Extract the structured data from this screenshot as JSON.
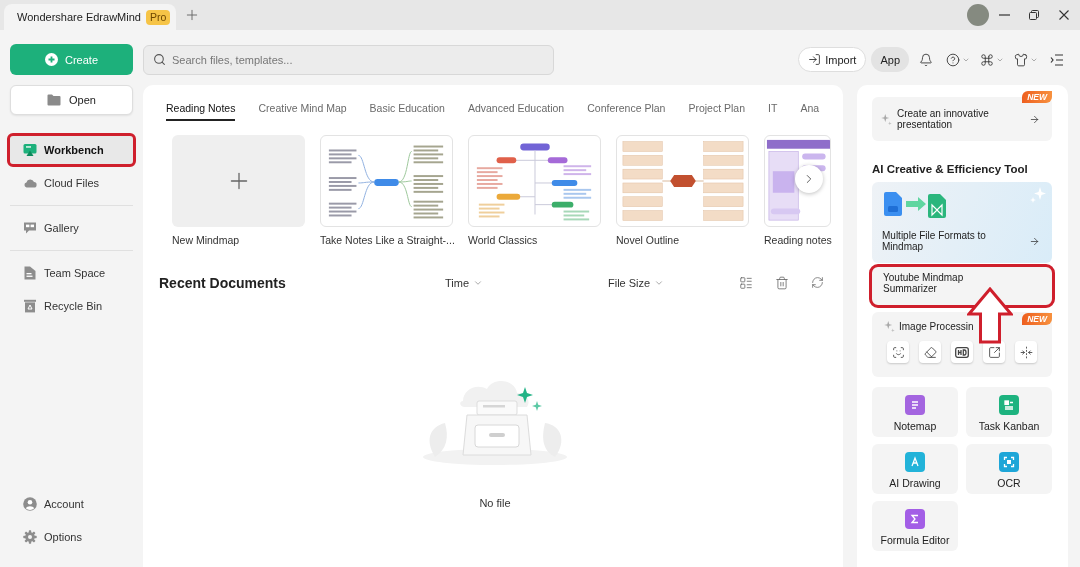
{
  "title_bar": {
    "app_name": "Wondershare EdrawMind",
    "badge": "Pro"
  },
  "toolbar": {
    "create_button": "Create",
    "search": {
      "placeholder": "Search files, templates..."
    },
    "import_button": "Import",
    "app_button": "App"
  },
  "sidebar": {
    "open_button": "Open",
    "groups": [
      {
        "items": [
          {
            "label": "Workbench",
            "selected": true,
            "highlighted": true
          },
          {
            "label": "Cloud Files",
            "selected": false,
            "highlighted": false
          }
        ]
      },
      {
        "items": [
          {
            "label": "Gallery",
            "selected": false,
            "highlighted": false
          }
        ]
      },
      {
        "items": [
          {
            "label": "Team Space",
            "selected": false,
            "highlighted": false
          },
          {
            "label": "Recycle Bin",
            "selected": false,
            "highlighted": false
          }
        ]
      }
    ],
    "bottom_items": [
      {
        "label": "Account",
        "selected": false
      },
      {
        "label": "Options",
        "selected": false
      }
    ]
  },
  "templates": {
    "tabs": [
      {
        "label": "Reading Notes",
        "selected": true
      },
      {
        "label": "Creative Mind Map",
        "selected": false
      },
      {
        "label": "Basic Education",
        "selected": false
      },
      {
        "label": "Advanced Education",
        "selected": false
      },
      {
        "label": "Conference Plan",
        "selected": false
      },
      {
        "label": "Project Plan",
        "selected": false
      },
      {
        "label": "IT",
        "selected": false
      },
      {
        "label": "Ana",
        "selected": false
      }
    ],
    "cards": [
      {
        "kind": "blank",
        "label": "New Mindmap"
      },
      {
        "kind": "radial",
        "label": "Take Notes Like a Straight-..."
      },
      {
        "kind": "tree",
        "label": "World Classics"
      },
      {
        "kind": "columns",
        "label": "Novel Outline"
      },
      {
        "kind": "board",
        "label": "Reading notes"
      }
    ]
  },
  "recent_documents": {
    "title": "Recent Documents",
    "sort_options": [
      "Time",
      "File Size"
    ],
    "empty_text": "No file"
  },
  "right_panel": {
    "promo": {
      "text": "Create an innovative presentation",
      "badge": "NEW"
    },
    "section_title": "AI Creative & Efficiency Tool",
    "feature_cards": [
      {
        "kind": "converter",
        "text": "Multiple File Formats to Mindmap",
        "highlighted": false,
        "arrow_pointer": false
      },
      {
        "kind": "plain",
        "text": "Youtube Mindmap Summarizer",
        "highlighted": true,
        "arrow_pointer": true
      },
      {
        "kind": "image-tools",
        "text": "Image Processin",
        "badge": "NEW",
        "highlighted": false,
        "arrow_pointer": false
      }
    ],
    "tiles": [
      {
        "label": "Notemap",
        "color": "#a465e0"
      },
      {
        "label": "Task Kanban",
        "color": "#1db37f"
      },
      {
        "label": "AI Drawing",
        "color": "#22b3d9"
      },
      {
        "label": "OCR",
        "color": "#1ea6d8"
      },
      {
        "label": "Formula Editor",
        "color": "#a35ee6"
      }
    ]
  }
}
